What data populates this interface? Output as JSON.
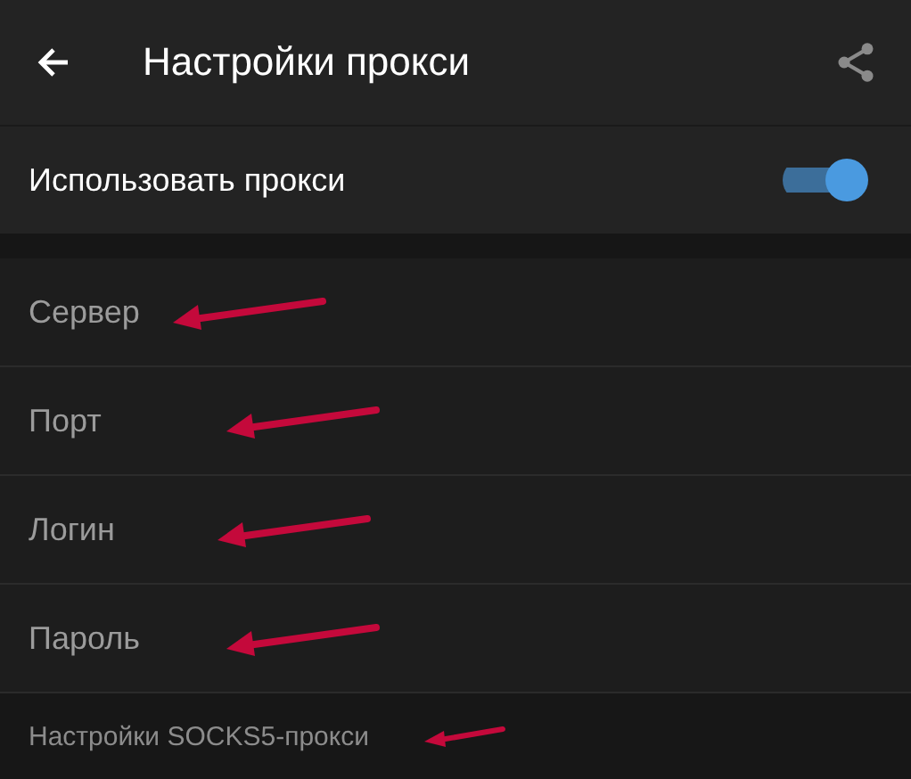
{
  "header": {
    "title": "Настройки прокси"
  },
  "toggle": {
    "label": "Использовать прокси",
    "on": true
  },
  "fields": [
    {
      "placeholder": "Сервер",
      "annotated": true
    },
    {
      "placeholder": "Порт",
      "annotated": true
    },
    {
      "placeholder": "Логин",
      "annotated": true
    },
    {
      "placeholder": "Пароль",
      "annotated": true
    }
  ],
  "footer": {
    "text": "Настройки SOCKS5-прокси",
    "annotated": true
  }
}
